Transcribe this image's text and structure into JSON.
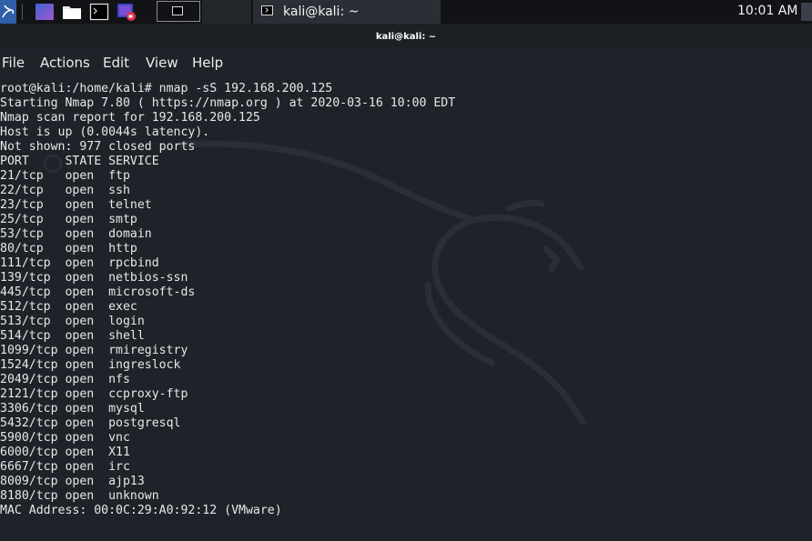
{
  "taskbar": {
    "window_title": "kali@kali: ~",
    "clock": "10:01 AM"
  },
  "window": {
    "title": "kali@kali: ~"
  },
  "menubar": {
    "file": "File",
    "actions": "Actions",
    "edit": "Edit",
    "view": "View",
    "help": "Help"
  },
  "terminal": {
    "lines": [
      "root@kali:/home/kali# nmap -sS 192.168.200.125",
      "Starting Nmap 7.80 ( https://nmap.org ) at 2020-03-16 10:00 EDT",
      "Nmap scan report for 192.168.200.125",
      "Host is up (0.0044s latency).",
      "Not shown: 977 closed ports",
      "PORT     STATE SERVICE",
      "21/tcp   open  ftp",
      "22/tcp   open  ssh",
      "23/tcp   open  telnet",
      "25/tcp   open  smtp",
      "53/tcp   open  domain",
      "80/tcp   open  http",
      "111/tcp  open  rpcbind",
      "139/tcp  open  netbios-ssn",
      "445/tcp  open  microsoft-ds",
      "512/tcp  open  exec",
      "513/tcp  open  login",
      "514/tcp  open  shell",
      "1099/tcp open  rmiregistry",
      "1524/tcp open  ingreslock",
      "2049/tcp open  nfs",
      "2121/tcp open  ccproxy-ftp",
      "3306/tcp open  mysql",
      "5432/tcp open  postgresql",
      "5900/tcp open  vnc",
      "6000/tcp open  X11",
      "6667/tcp open  irc",
      "8009/tcp open  ajp13",
      "8180/tcp open  unknown",
      "MAC Address: 00:0C:29:A0:92:12 (VMware)"
    ]
  },
  "colors": {
    "terminal_bg": "#1f2329",
    "terminal_fg": "#e7e7e7",
    "panel_bg": "#121316",
    "kali_blue": "#2e5fa8"
  },
  "icons": [
    "kali-menu-icon",
    "desktop-icon",
    "files-icon",
    "terminal-icon",
    "screen-recorder-icon"
  ]
}
